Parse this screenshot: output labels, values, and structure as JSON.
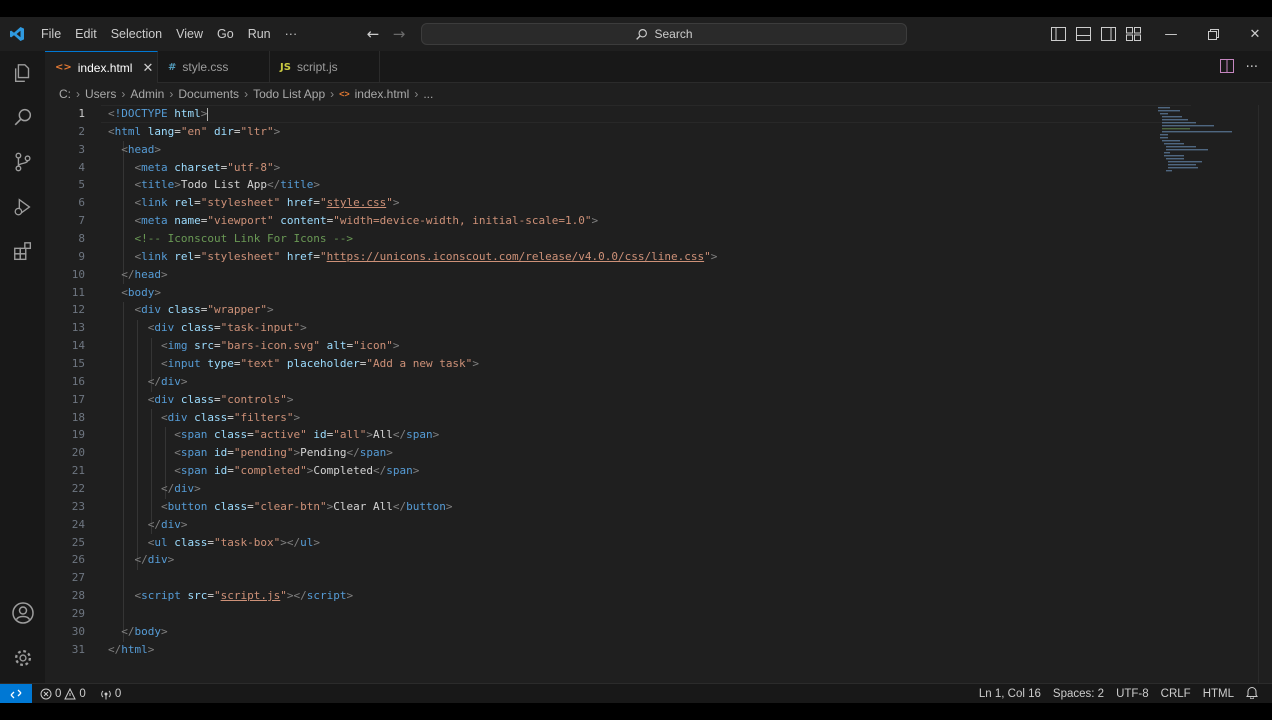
{
  "colors": {
    "accent": "#0078d4",
    "editor_bg": "#1f1f1f",
    "sidebar_bg": "#181818",
    "tag": "#569cd6",
    "attr": "#9cdcfe",
    "string": "#ce9178",
    "comment": "#6a9955"
  },
  "titlebar": {
    "app_icon": "vscode-logo-icon",
    "menu": [
      "File",
      "Edit",
      "Selection",
      "View",
      "Go",
      "Run",
      "···"
    ],
    "search_placeholder": "Search"
  },
  "activity_bar": {
    "top": [
      "explorer-icon",
      "search-icon",
      "source-control-icon",
      "run-debug-icon",
      "extensions-icon"
    ],
    "bottom": [
      "accounts-icon",
      "manage-gear-icon"
    ]
  },
  "tabs": [
    {
      "icon": "<>",
      "label": "index.html",
      "active": true
    },
    {
      "icon": "#",
      "label": "style.css",
      "active": false
    },
    {
      "icon": "JS",
      "label": "script.js",
      "active": false
    }
  ],
  "breadcrumb": [
    "C:",
    "Users",
    "Admin",
    "Documents",
    "Todo List App",
    "index.html",
    "..."
  ],
  "editor": {
    "current_line": 1,
    "line_numbers": [
      "1",
      "2",
      "3",
      "4",
      "5",
      "6",
      "7",
      "8",
      "9",
      "10",
      "11",
      "12",
      "13",
      "14",
      "15",
      "16",
      "17",
      "18",
      "19",
      "20",
      "21",
      "22",
      "23",
      "24",
      "25",
      "26",
      "27",
      "28",
      "29",
      "30",
      "31"
    ],
    "lines": [
      [
        [
          "br",
          "<"
        ],
        [
          "tag",
          "!DOCTYPE"
        ],
        [
          "txt",
          " "
        ],
        [
          "attr",
          "html"
        ],
        [
          "br",
          ">"
        ]
      ],
      [
        [
          "br",
          "<"
        ],
        [
          "tag",
          "html"
        ],
        [
          "txt",
          " "
        ],
        [
          "attr",
          "lang"
        ],
        [
          "eq",
          "="
        ],
        [
          "str",
          "\"en\""
        ],
        [
          "txt",
          " "
        ],
        [
          "attr",
          "dir"
        ],
        [
          "eq",
          "="
        ],
        [
          "str",
          "\"ltr\""
        ],
        [
          "br",
          ">"
        ]
      ],
      [
        [
          "br",
          "<"
        ],
        [
          "tag",
          "head"
        ],
        [
          "br",
          ">"
        ]
      ],
      [
        [
          "br",
          "<"
        ],
        [
          "tag",
          "meta"
        ],
        [
          "txt",
          " "
        ],
        [
          "attr",
          "charset"
        ],
        [
          "eq",
          "="
        ],
        [
          "str",
          "\"utf-8\""
        ],
        [
          "br",
          ">"
        ]
      ],
      [
        [
          "br",
          "<"
        ],
        [
          "tag",
          "title"
        ],
        [
          "br",
          ">"
        ],
        [
          "txt",
          "Todo List App"
        ],
        [
          "br",
          "</"
        ],
        [
          "tag",
          "title"
        ],
        [
          "br",
          ">"
        ]
      ],
      [
        [
          "br",
          "<"
        ],
        [
          "tag",
          "link"
        ],
        [
          "txt",
          " "
        ],
        [
          "attr",
          "rel"
        ],
        [
          "eq",
          "="
        ],
        [
          "str",
          "\"stylesheet\""
        ],
        [
          "txt",
          " "
        ],
        [
          "attr",
          "href"
        ],
        [
          "eq",
          "="
        ],
        [
          "str",
          "\""
        ],
        [
          "link",
          "style.css"
        ],
        [
          "str",
          "\""
        ],
        [
          "br",
          ">"
        ]
      ],
      [
        [
          "br",
          "<"
        ],
        [
          "tag",
          "meta"
        ],
        [
          "txt",
          " "
        ],
        [
          "attr",
          "name"
        ],
        [
          "eq",
          "="
        ],
        [
          "str",
          "\"viewport\""
        ],
        [
          "txt",
          " "
        ],
        [
          "attr",
          "content"
        ],
        [
          "eq",
          "="
        ],
        [
          "str",
          "\"width=device-width, initial-scale=1.0\""
        ],
        [
          "br",
          ">"
        ]
      ],
      [
        [
          "cmt",
          "<!-- Iconscout Link For Icons -->"
        ]
      ],
      [
        [
          "br",
          "<"
        ],
        [
          "tag",
          "link"
        ],
        [
          "txt",
          " "
        ],
        [
          "attr",
          "rel"
        ],
        [
          "eq",
          "="
        ],
        [
          "str",
          "\"stylesheet\""
        ],
        [
          "txt",
          " "
        ],
        [
          "attr",
          "href"
        ],
        [
          "eq",
          "="
        ],
        [
          "str",
          "\""
        ],
        [
          "link",
          "https://unicons.iconscout.com/release/v4.0.0/css/line.css"
        ],
        [
          "str",
          "\""
        ],
        [
          "br",
          ">"
        ]
      ],
      [
        [
          "br",
          "</"
        ],
        [
          "tag",
          "head"
        ],
        [
          "br",
          ">"
        ]
      ],
      [
        [
          "br",
          "<"
        ],
        [
          "tag",
          "body"
        ],
        [
          "br",
          ">"
        ]
      ],
      [
        [
          "br",
          "<"
        ],
        [
          "tag",
          "div"
        ],
        [
          "txt",
          " "
        ],
        [
          "attr",
          "class"
        ],
        [
          "eq",
          "="
        ],
        [
          "str",
          "\"wrapper\""
        ],
        [
          "br",
          ">"
        ]
      ],
      [
        [
          "br",
          "<"
        ],
        [
          "tag",
          "div"
        ],
        [
          "txt",
          " "
        ],
        [
          "attr",
          "class"
        ],
        [
          "eq",
          "="
        ],
        [
          "str",
          "\"task-input\""
        ],
        [
          "br",
          ">"
        ]
      ],
      [
        [
          "br",
          "<"
        ],
        [
          "tag",
          "img"
        ],
        [
          "txt",
          " "
        ],
        [
          "attr",
          "src"
        ],
        [
          "eq",
          "="
        ],
        [
          "str",
          "\"bars-icon.svg\""
        ],
        [
          "txt",
          " "
        ],
        [
          "attr",
          "alt"
        ],
        [
          "eq",
          "="
        ],
        [
          "str",
          "\"icon\""
        ],
        [
          "br",
          ">"
        ]
      ],
      [
        [
          "br",
          "<"
        ],
        [
          "tag",
          "input"
        ],
        [
          "txt",
          " "
        ],
        [
          "attr",
          "type"
        ],
        [
          "eq",
          "="
        ],
        [
          "str",
          "\"text\""
        ],
        [
          "txt",
          " "
        ],
        [
          "attr",
          "placeholder"
        ],
        [
          "eq",
          "="
        ],
        [
          "str",
          "\"Add a new task\""
        ],
        [
          "br",
          ">"
        ]
      ],
      [
        [
          "br",
          "</"
        ],
        [
          "tag",
          "div"
        ],
        [
          "br",
          ">"
        ]
      ],
      [
        [
          "br",
          "<"
        ],
        [
          "tag",
          "div"
        ],
        [
          "txt",
          " "
        ],
        [
          "attr",
          "class"
        ],
        [
          "eq",
          "="
        ],
        [
          "str",
          "\"controls\""
        ],
        [
          "br",
          ">"
        ]
      ],
      [
        [
          "br",
          "<"
        ],
        [
          "tag",
          "div"
        ],
        [
          "txt",
          " "
        ],
        [
          "attr",
          "class"
        ],
        [
          "eq",
          "="
        ],
        [
          "str",
          "\"filters\""
        ],
        [
          "br",
          ">"
        ]
      ],
      [
        [
          "br",
          "<"
        ],
        [
          "tag",
          "span"
        ],
        [
          "txt",
          " "
        ],
        [
          "attr",
          "class"
        ],
        [
          "eq",
          "="
        ],
        [
          "str",
          "\"active\""
        ],
        [
          "txt",
          " "
        ],
        [
          "attr",
          "id"
        ],
        [
          "eq",
          "="
        ],
        [
          "str",
          "\"all\""
        ],
        [
          "br",
          ">"
        ],
        [
          "txt",
          "All"
        ],
        [
          "br",
          "</"
        ],
        [
          "tag",
          "span"
        ],
        [
          "br",
          ">"
        ]
      ],
      [
        [
          "br",
          "<"
        ],
        [
          "tag",
          "span"
        ],
        [
          "txt",
          " "
        ],
        [
          "attr",
          "id"
        ],
        [
          "eq",
          "="
        ],
        [
          "str",
          "\"pending\""
        ],
        [
          "br",
          ">"
        ],
        [
          "txt",
          "Pending"
        ],
        [
          "br",
          "</"
        ],
        [
          "tag",
          "span"
        ],
        [
          "br",
          ">"
        ]
      ],
      [
        [
          "br",
          "<"
        ],
        [
          "tag",
          "span"
        ],
        [
          "txt",
          " "
        ],
        [
          "attr",
          "id"
        ],
        [
          "eq",
          "="
        ],
        [
          "str",
          "\"completed\""
        ],
        [
          "br",
          ">"
        ],
        [
          "txt",
          "Completed"
        ],
        [
          "br",
          "</"
        ],
        [
          "tag",
          "span"
        ],
        [
          "br",
          ">"
        ]
      ],
      [
        [
          "br",
          "</"
        ],
        [
          "tag",
          "div"
        ],
        [
          "br",
          ">"
        ]
      ],
      [
        [
          "br",
          "<"
        ],
        [
          "tag",
          "button"
        ],
        [
          "txt",
          " "
        ],
        [
          "attr",
          "class"
        ],
        [
          "eq",
          "="
        ],
        [
          "str",
          "\"clear-btn\""
        ],
        [
          "br",
          ">"
        ],
        [
          "txt",
          "Clear All"
        ],
        [
          "br",
          "</"
        ],
        [
          "tag",
          "button"
        ],
        [
          "br",
          ">"
        ]
      ],
      [
        [
          "br",
          "</"
        ],
        [
          "tag",
          "div"
        ],
        [
          "br",
          ">"
        ]
      ],
      [
        [
          "br",
          "<"
        ],
        [
          "tag",
          "ul"
        ],
        [
          "txt",
          " "
        ],
        [
          "attr",
          "class"
        ],
        [
          "eq",
          "="
        ],
        [
          "str",
          "\"task-box\""
        ],
        [
          "br",
          "></"
        ],
        [
          "tag",
          "ul"
        ],
        [
          "br",
          ">"
        ]
      ],
      [
        [
          "br",
          "</"
        ],
        [
          "tag",
          "div"
        ],
        [
          "br",
          ">"
        ]
      ],
      [],
      [
        [
          "br",
          "<"
        ],
        [
          "tag",
          "script"
        ],
        [
          "txt",
          " "
        ],
        [
          "attr",
          "src"
        ],
        [
          "eq",
          "="
        ],
        [
          "str",
          "\""
        ],
        [
          "link",
          "script.js"
        ],
        [
          "str",
          "\""
        ],
        [
          "br",
          "></"
        ],
        [
          "tag",
          "script"
        ],
        [
          "br",
          ">"
        ]
      ],
      [],
      [
        [
          "br",
          "</"
        ],
        [
          "tag",
          "body"
        ],
        [
          "br",
          ">"
        ]
      ],
      [
        [
          "br",
          "</"
        ],
        [
          "tag",
          "html"
        ],
        [
          "br",
          ">"
        ]
      ]
    ]
  },
  "statusbar": {
    "remote_icon": "remote-icon",
    "errors": "0",
    "warnings": "0",
    "ports": "0",
    "position": "Ln 1, Col 16",
    "spaces": "Spaces: 2",
    "encoding": "UTF-8",
    "eol": "CRLF",
    "language": "HTML",
    "notifications_icon": "bell-icon"
  }
}
